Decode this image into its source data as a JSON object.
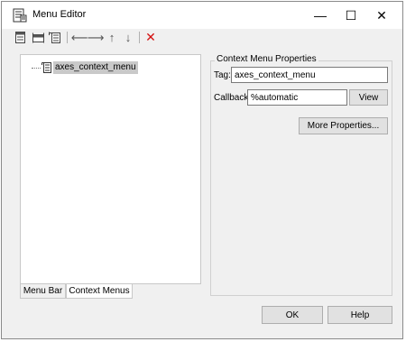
{
  "window": {
    "title": "Menu Editor",
    "controls": {
      "minimize": "—",
      "maximize": "☐",
      "close": "✕"
    }
  },
  "toolbar": {
    "items": [
      {
        "name": "new-menu",
        "icon": "new-menu-icon"
      },
      {
        "name": "new-menu-item",
        "icon": "new-menu-item-icon"
      },
      {
        "name": "new-context-menu",
        "icon": "new-context-menu-icon"
      },
      {
        "name": "move-left",
        "icon": "arrow-left-icon",
        "glyph": "⟵"
      },
      {
        "name": "move-right",
        "icon": "arrow-right-icon",
        "glyph": "⟶"
      },
      {
        "name": "move-up",
        "icon": "arrow-up-icon",
        "glyph": "↑"
      },
      {
        "name": "move-down",
        "icon": "arrow-down-icon",
        "glyph": "↓"
      },
      {
        "name": "delete",
        "icon": "delete-icon",
        "glyph": "✕",
        "color": "#d41010"
      }
    ]
  },
  "tree": {
    "items": [
      {
        "label": "axes_context_menu",
        "selected": true
      }
    ]
  },
  "tabs": [
    {
      "label": "Menu Bar",
      "active": false
    },
    {
      "label": "Context Menus",
      "active": true
    }
  ],
  "properties": {
    "title": "Context Menu Properties",
    "tag_label": "Tag:",
    "tag_value": "axes_context_menu",
    "callback_label": "Callback:",
    "callback_value": "%automatic",
    "view_button": "View",
    "more_properties_button": "More Properties..."
  },
  "footer": {
    "ok_button": "OK",
    "help_button": "Help"
  }
}
